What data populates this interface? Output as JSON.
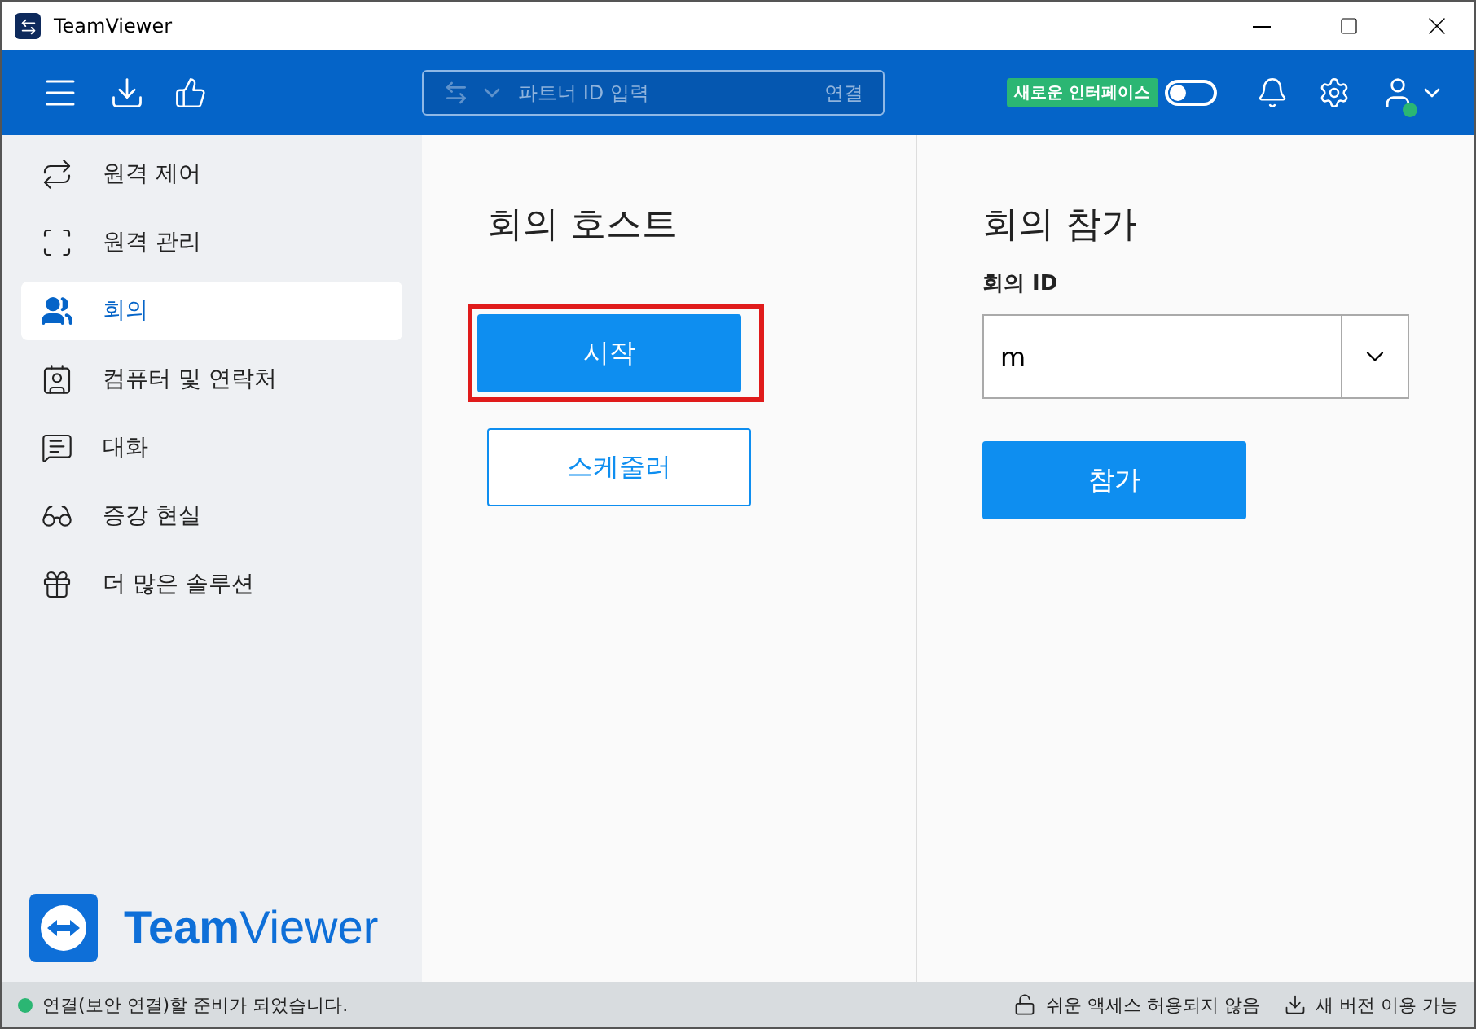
{
  "window": {
    "title": "TeamViewer"
  },
  "toolbar": {
    "partner_placeholder": "파트너 ID 입력",
    "connect": "연결",
    "new_ui_badge": "새로운 인터페이스",
    "new_ui_on": false,
    "online": true
  },
  "sidebar": {
    "items": [
      {
        "label": "원격 제어",
        "selected": false
      },
      {
        "label": "원격 관리",
        "selected": false
      },
      {
        "label": "회의",
        "selected": true
      },
      {
        "label": "컴퓨터 및 연락처",
        "selected": false
      },
      {
        "label": "대화",
        "selected": false
      },
      {
        "label": "증강 현실",
        "selected": false
      },
      {
        "label": "더 많은 솔루션",
        "selected": false
      }
    ],
    "logo": "**Team**Viewer"
  },
  "host": {
    "title": "회의 호스트",
    "start": "시작",
    "start_highlighted": true,
    "schedule": "스케줄러"
  },
  "join": {
    "title": "회의 참가",
    "id_label": "회의 ID",
    "id_value": "m",
    "join": "참가"
  },
  "status_bar": {
    "message": "연결(보안 연결)할 준비가 되었습니다.",
    "ready": true,
    "easy_access": "쉬운 액세스 허용되지 않음",
    "update": "새 버전 이용 가능"
  }
}
